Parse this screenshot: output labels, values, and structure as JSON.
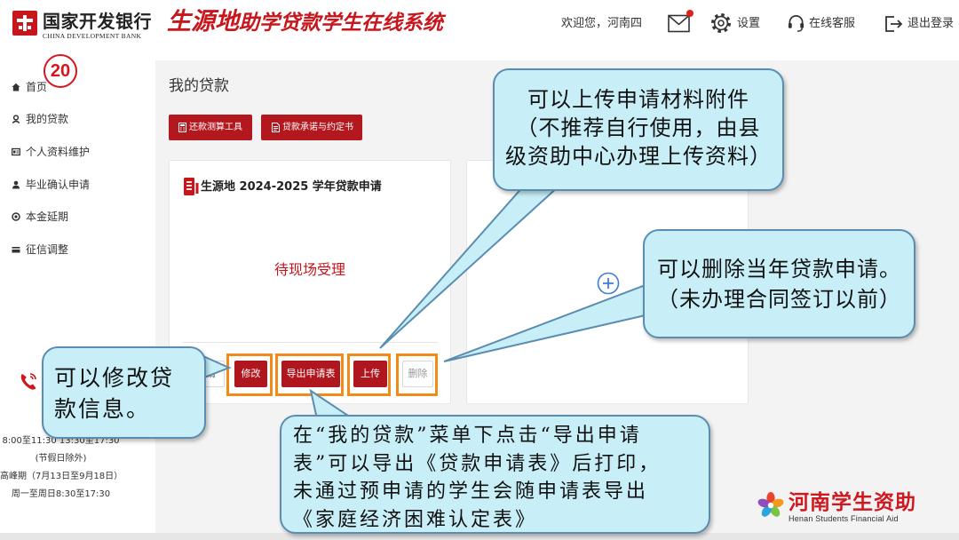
{
  "header": {
    "bank_name": "国家开发银行",
    "bank_name_en": "CHINA DEVELOPMENT BANK",
    "system_title_prefix": "生源地",
    "system_title_rest": "助学贷款学生在线系统",
    "welcome": "欢迎您，河南四",
    "settings": "设置",
    "support": "在线客服",
    "logout": "退出登录",
    "icons": [
      "bank-logo-icon",
      "mail-icon",
      "gear-icon",
      "headset-icon",
      "logout-icon"
    ],
    "mail_has_unread_dot": true
  },
  "step_badge": "20",
  "sidebar": {
    "items": [
      {
        "label": "首页",
        "icon": "home-icon"
      },
      {
        "label": "我的贷款",
        "icon": "loan-user-icon"
      },
      {
        "label": "个人资料维护",
        "icon": "profile-card-icon"
      },
      {
        "label": "毕业确认申请",
        "icon": "user-icon"
      },
      {
        "label": "本金延期",
        "icon": "deferral-icon"
      },
      {
        "label": "征信调整",
        "icon": "credit-card-icon"
      }
    ]
  },
  "service": {
    "icon": "phone-icon",
    "lines": [
      "8:00至11:30 13:30至17:30",
      "(节假日除外)",
      "高峰期（7月13日至9月18日）",
      "周一至周日8:30至17:30"
    ]
  },
  "main": {
    "title": "我的贷款",
    "toolbar": [
      {
        "label": "还款测算工具",
        "icon": "calculator-icon"
      },
      {
        "label": "贷款承诺与约定书",
        "icon": "document-icon"
      }
    ],
    "loan_card": {
      "icon": "application-icon",
      "title": "生源地 2024-2025 学年贷款申请",
      "status": "待现场受理",
      "actions": [
        {
          "label": "请"
        },
        {
          "label": "修改"
        },
        {
          "label": "导出申请表"
        },
        {
          "label": "上传"
        },
        {
          "label": "删除"
        }
      ]
    },
    "add_card": {
      "icon": "plus-circle-icon"
    }
  },
  "callouts": {
    "upload": {
      "lines": [
        "可以上传申请材料附件",
        "（不推荐自行使用，由县",
        "级资助中心办理上传资料）"
      ]
    },
    "delete": {
      "lines": [
        "可以删除当年贷款申请。",
        "（未办理合同签订以前）"
      ]
    },
    "edit": {
      "lines": [
        "可以修改贷",
        "款信息。"
      ]
    },
    "export": {
      "lines": [
        "在“我的贷款”菜单下点击“导出申请",
        "表”可以导出《贷款申请表》后打印，",
        "未通过预申请的学生会随申请表导出",
        "《家庭经济困难认定表》"
      ]
    }
  },
  "footer_logo": {
    "name": "河南学生资助",
    "name_en": "Henan Students Financial Aid",
    "icon": "flower-logo-icon"
  },
  "colors": {
    "brand_red": "#b0161d",
    "status_red": "#c3161c",
    "callout_fill": "#c8eef8",
    "callout_border": "#5a8db0",
    "highlight_orange": "#f28a1a",
    "add_blue": "#3a7ed6",
    "page_bg": "#f3f3f3"
  }
}
